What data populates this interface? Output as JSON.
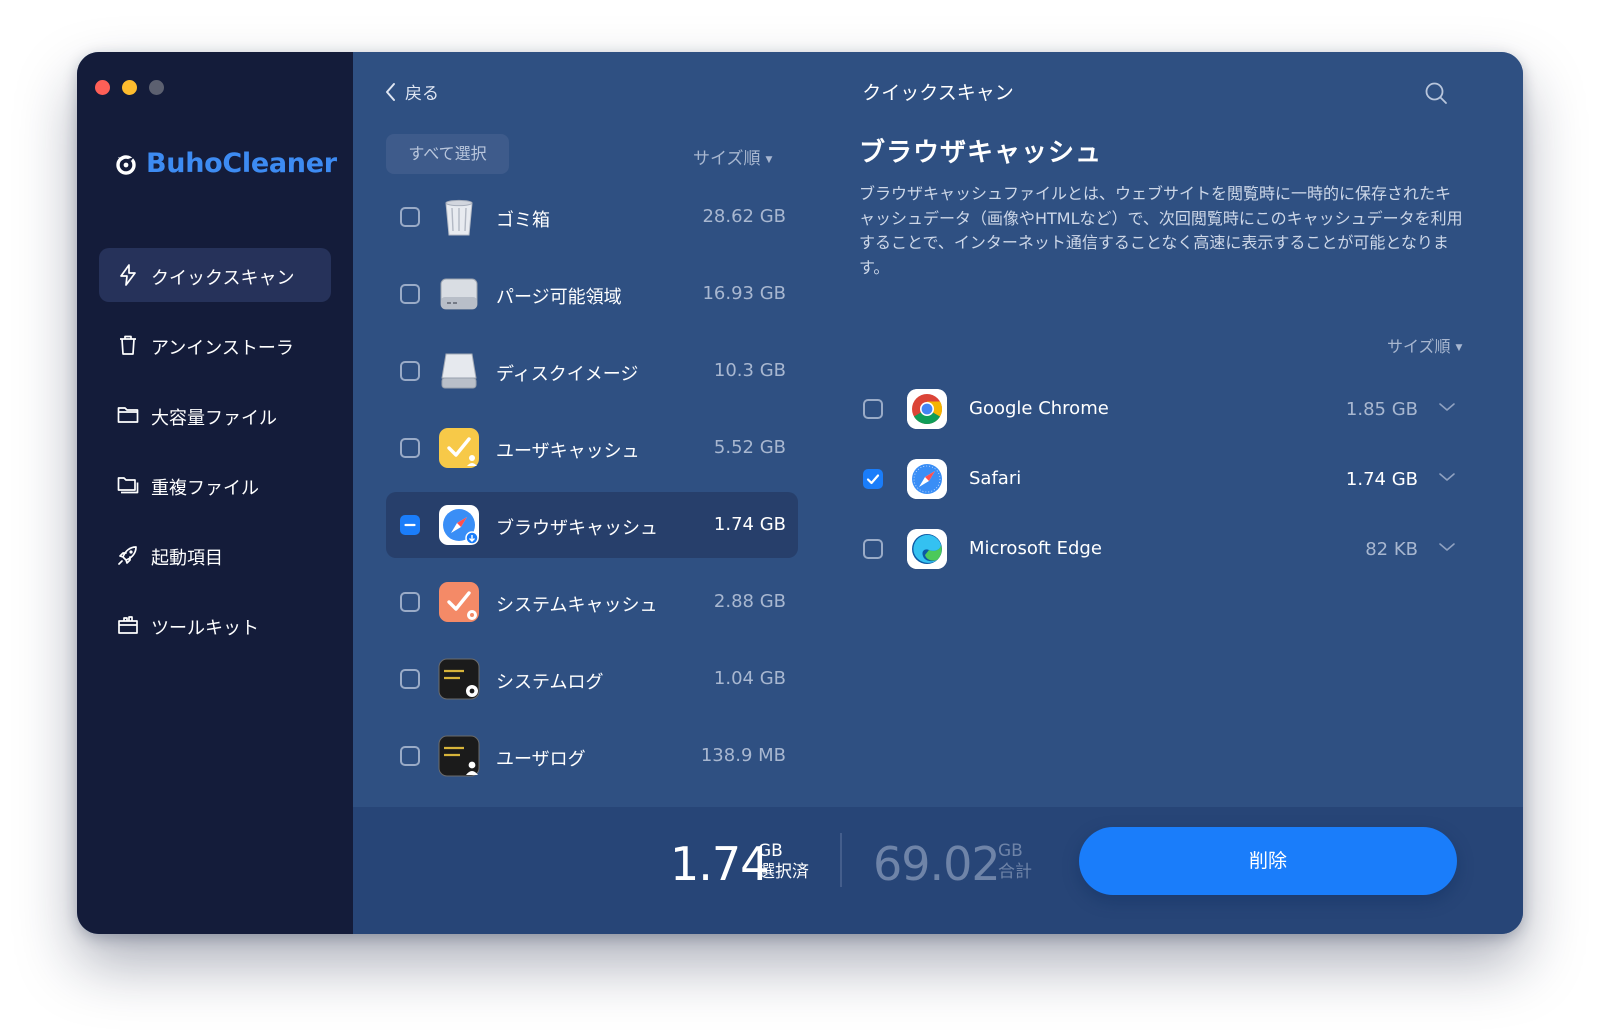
{
  "app": {
    "name": "BuhoCleaner"
  },
  "sidebar": {
    "items": [
      {
        "label": "クイックスキャン",
        "icon": "lightning-icon",
        "active": true
      },
      {
        "label": "アンインストーラ",
        "icon": "trash-icon",
        "active": false
      },
      {
        "label": "大容量ファイル",
        "icon": "folder-icon",
        "active": false
      },
      {
        "label": "重複ファイル",
        "icon": "duplicate-folder-icon",
        "active": false
      },
      {
        "label": "起動項目",
        "icon": "rocket-icon",
        "active": false
      },
      {
        "label": "ツールキット",
        "icon": "toolkit-icon",
        "active": false
      }
    ]
  },
  "header": {
    "back_label": "戻る",
    "title": "クイックスキャン"
  },
  "list": {
    "select_all_label": "すべて選択",
    "sort_label": "サイズ順",
    "items": [
      {
        "label": "ゴミ箱",
        "size": "28.62 GB",
        "icon": "trash-can-icon",
        "checked": false
      },
      {
        "label": "パージ可能領域",
        "size": "16.93 GB",
        "icon": "disk-drive-icon",
        "checked": false
      },
      {
        "label": "ディスクイメージ",
        "size": "10.3 GB",
        "icon": "disk-image-icon",
        "checked": false
      },
      {
        "label": "ユーザキャッシュ",
        "size": "5.52 GB",
        "icon": "user-cache-icon",
        "checked": false
      },
      {
        "label": "ブラウザキャッシュ",
        "size": "1.74 GB",
        "icon": "browser-cache-icon",
        "checked": "partial",
        "selected": true
      },
      {
        "label": "システムキャッシュ",
        "size": "2.88 GB",
        "icon": "system-cache-icon",
        "checked": false
      },
      {
        "label": "システムログ",
        "size": "1.04 GB",
        "icon": "system-log-icon",
        "checked": false
      },
      {
        "label": "ユーザログ",
        "size": "138.9 MB",
        "icon": "user-log-icon",
        "checked": false
      }
    ]
  },
  "detail": {
    "title": "ブラウザキャッシュ",
    "description": "ブラウザキャッシュファイルとは、ウェブサイトを閲覧時に一時的に保存されたキャッシュデータ（画像やHTMLなど）で、次回閲覧時にこのキャッシュデータを利用することで、インターネット通信することなく高速に表示することが可能となります。",
    "sort_label": "サイズ順",
    "browsers": [
      {
        "label": "Google Chrome",
        "size": "1.85 GB",
        "icon": "chrome-icon",
        "checked": false
      },
      {
        "label": "Safari",
        "size": "1.74 GB",
        "icon": "safari-icon",
        "checked": true
      },
      {
        "label": "Microsoft Edge",
        "size": "82 KB",
        "icon": "edge-icon",
        "checked": false
      }
    ]
  },
  "footer": {
    "selected_value": "1.74",
    "selected_unit": "GB",
    "selected_caption": "選択済",
    "total_value": "69.02",
    "total_unit": "GB",
    "total_caption": "合計",
    "delete_label": "削除"
  },
  "colors": {
    "sidebar_bg": "#141c3a",
    "main_bg": "#2f5082",
    "footer_bg": "#274577",
    "accent": "#1a7dfa",
    "brand": "#3d8bf2"
  }
}
